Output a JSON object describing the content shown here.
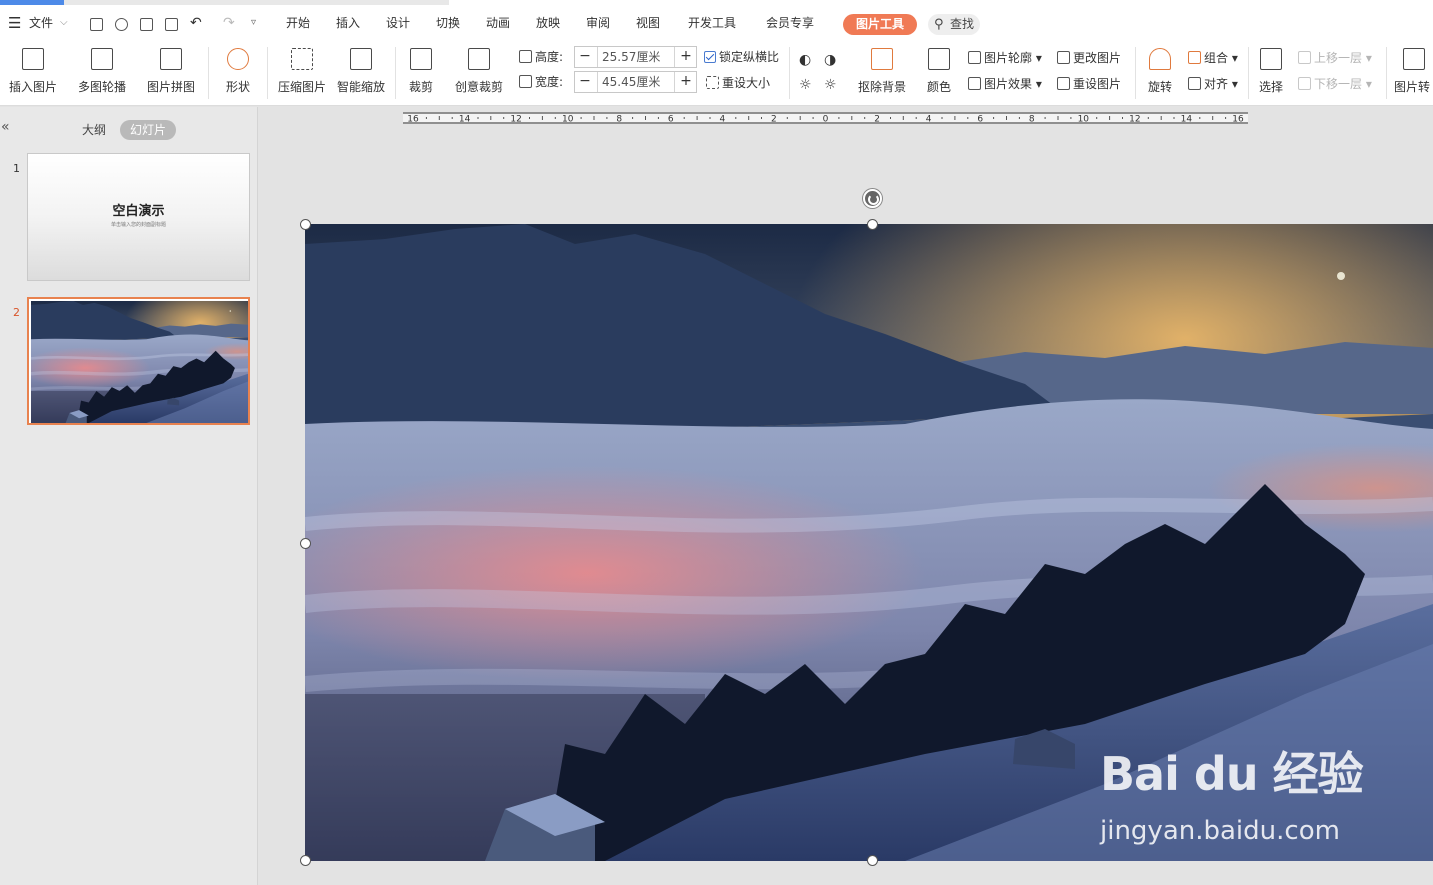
{
  "menu": {
    "file": "文件",
    "tabs": [
      "开始",
      "插入",
      "设计",
      "切换",
      "动画",
      "放映",
      "审阅",
      "视图",
      "开发工具",
      "会员专享"
    ],
    "active_tab": "图片工具",
    "search": "查找"
  },
  "ribbon": {
    "insert_picture": "插入图片",
    "multi_carousel": "多图轮播",
    "picture_collage": "图片拼图",
    "shape": "形状",
    "compress": "压缩图片",
    "smart_zoom": "智能缩放",
    "crop": "裁剪",
    "creative_crop": "创意裁剪",
    "height_label": "高度:",
    "height_value": "25.57厘米",
    "width_label": "宽度:",
    "width_value": "45.45厘米",
    "lock_ratio": "锁定纵横比",
    "reset_size": "重设大小",
    "remove_bg": "抠除背景",
    "color": "颜色",
    "outline": "图片轮廓",
    "effect": "图片效果",
    "change_pic": "更改图片",
    "reset_pic": "重设图片",
    "rotate": "旋转",
    "group": "组合",
    "align": "对齐",
    "select": "选择",
    "bring_forward": "上移一层",
    "send_backward": "下移一层",
    "pic_convert": "图片转"
  },
  "panel": {
    "collapse": "«",
    "tab_outline": "大纲",
    "tab_slides": "幻灯片",
    "slides": [
      {
        "num": "1",
        "title": "空白演示",
        "subtitle": "单击输入您的封面副标题"
      },
      {
        "num": "2"
      }
    ]
  },
  "ruler": [
    "16",
    "14",
    "12",
    "10",
    "8",
    "6",
    "4",
    "2",
    "0",
    "2",
    "4",
    "6",
    "8",
    "10",
    "12",
    "14",
    "16"
  ],
  "watermark": {
    "logo": "Bai du 经验",
    "url": "jingyan.baidu.com"
  }
}
